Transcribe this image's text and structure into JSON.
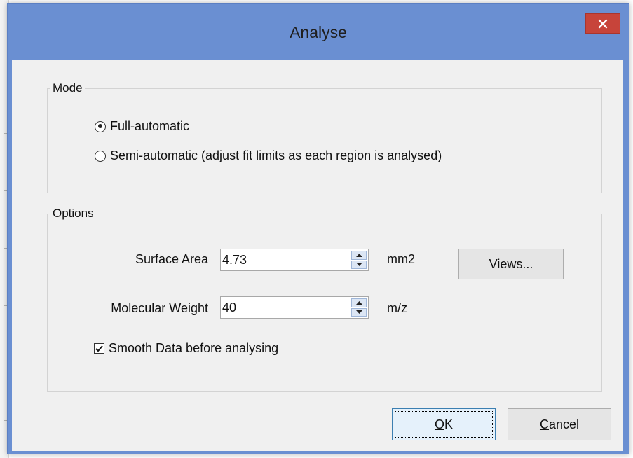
{
  "window": {
    "title": "Analyse"
  },
  "mode_group": {
    "legend": "Mode",
    "options": [
      {
        "label": "Full-automatic",
        "selected": true
      },
      {
        "label": "Semi-automatic (adjust fit limits as each region is analysed)",
        "selected": false
      }
    ]
  },
  "options_group": {
    "legend": "Options",
    "surface_area": {
      "label": "Surface Area",
      "value": "4.73",
      "unit": "mm2"
    },
    "molecular_weight": {
      "label": "Molecular Weight",
      "value": "40",
      "unit": "m/z"
    },
    "views_button": "Views...",
    "smooth_data": {
      "label": "Smooth Data before analysing",
      "checked": true
    }
  },
  "buttons": {
    "ok": {
      "mnemonic": "O",
      "rest": "K"
    },
    "cancel": {
      "mnemonic": "C",
      "rest": "ancel"
    }
  },
  "colors": {
    "titlebar": "#6a8fd2",
    "close_button": "#c7443a",
    "dialog_background": "#f0f0f0"
  }
}
